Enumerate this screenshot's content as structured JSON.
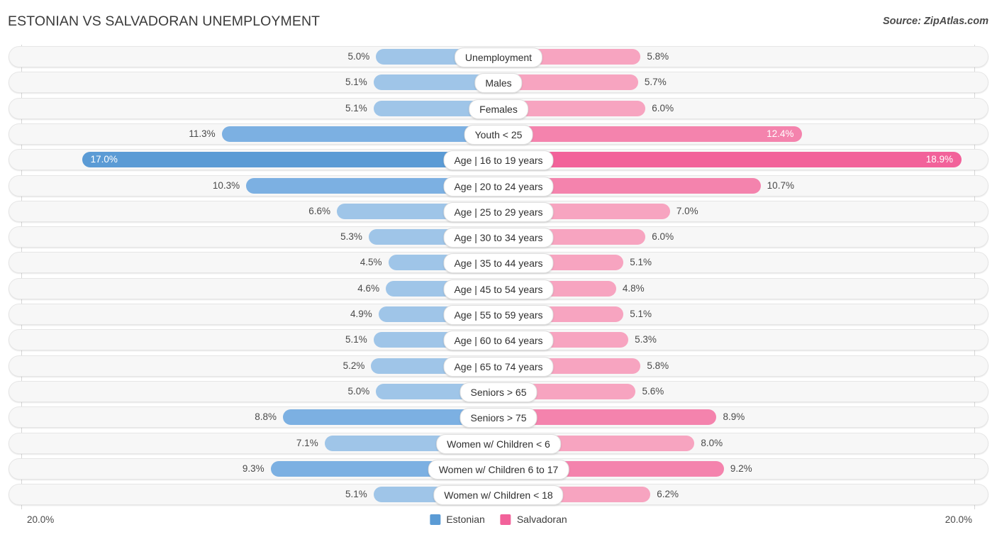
{
  "header": {
    "title": "ESTONIAN VS SALVADORAN UNEMPLOYMENT",
    "source": "Source: ZipAtlas.com"
  },
  "axis": {
    "left_max": "20.0%",
    "right_max": "20.0%"
  },
  "legend": {
    "items": [
      {
        "label": "Estonian",
        "color": "#5b9bd5"
      },
      {
        "label": "Salvadoran",
        "color": "#f2629a"
      }
    ]
  },
  "colors": {
    "left_normal": "#9fc5e8",
    "left_mid": "#7cb0e2",
    "left_high": "#5b9bd5",
    "right_normal": "#f7a4c0",
    "right_mid": "#f483ad",
    "right_high": "#f2629a",
    "track_bg": "#f7f7f7",
    "track_border": "#e6e6e6"
  },
  "chart_data": {
    "type": "bar",
    "title": "ESTONIAN VS SALVADORAN UNEMPLOYMENT",
    "subtitle": "",
    "orientation": "horizontal-diverging",
    "xlabel": "",
    "ylabel": "",
    "xlim": [
      0,
      20
    ],
    "axis_max_label": "20.0%",
    "grid": false,
    "legend_position": "bottom-center",
    "categories": [
      "Unemployment",
      "Males",
      "Females",
      "Youth < 25",
      "Age | 16 to 19 years",
      "Age | 20 to 24 years",
      "Age | 25 to 29 years",
      "Age | 30 to 34 years",
      "Age | 35 to 44 years",
      "Age | 45 to 54 years",
      "Age | 55 to 59 years",
      "Age | 60 to 64 years",
      "Age | 65 to 74 years",
      "Seniors > 65",
      "Seniors > 75",
      "Women w/ Children < 6",
      "Women w/ Children 6 to 17",
      "Women w/ Children < 18"
    ],
    "series": [
      {
        "name": "Estonian",
        "side": "left",
        "values": [
          5.0,
          5.1,
          5.1,
          11.3,
          17.0,
          10.3,
          6.6,
          5.3,
          4.5,
          4.6,
          4.9,
          5.1,
          5.2,
          5.0,
          8.8,
          7.1,
          9.3,
          5.1
        ],
        "labels": [
          "5.0%",
          "5.1%",
          "5.1%",
          "11.3%",
          "17.0%",
          "10.3%",
          "6.6%",
          "5.3%",
          "4.5%",
          "4.6%",
          "4.9%",
          "5.1%",
          "5.2%",
          "5.0%",
          "8.8%",
          "7.1%",
          "9.3%",
          "5.1%"
        ]
      },
      {
        "name": "Salvadoran",
        "side": "right",
        "values": [
          5.8,
          5.7,
          6.0,
          12.4,
          18.9,
          10.7,
          7.0,
          6.0,
          5.1,
          4.8,
          5.1,
          5.3,
          5.8,
          5.6,
          8.9,
          8.0,
          9.2,
          6.2
        ],
        "labels": [
          "5.8%",
          "5.7%",
          "6.0%",
          "12.4%",
          "18.9%",
          "10.7%",
          "7.0%",
          "6.0%",
          "5.1%",
          "4.8%",
          "5.1%",
          "5.3%",
          "5.8%",
          "5.6%",
          "8.9%",
          "8.0%",
          "9.2%",
          "6.2%"
        ]
      }
    ],
    "rows": [
      {
        "label": "Unemployment",
        "left": 5.0,
        "left_label": "5.0%",
        "right": 5.8,
        "right_label": "5.8%",
        "left_shade": "normal",
        "right_shade": "normal",
        "left_inside": false,
        "right_inside": false
      },
      {
        "label": "Males",
        "left": 5.1,
        "left_label": "5.1%",
        "right": 5.7,
        "right_label": "5.7%",
        "left_shade": "normal",
        "right_shade": "normal",
        "left_inside": false,
        "right_inside": false
      },
      {
        "label": "Females",
        "left": 5.1,
        "left_label": "5.1%",
        "right": 6.0,
        "right_label": "6.0%",
        "left_shade": "normal",
        "right_shade": "normal",
        "left_inside": false,
        "right_inside": false
      },
      {
        "label": "Youth < 25",
        "left": 11.3,
        "left_label": "11.3%",
        "right": 12.4,
        "right_label": "12.4%",
        "left_shade": "mid",
        "right_shade": "mid",
        "left_inside": false,
        "right_inside": true
      },
      {
        "label": "Age | 16 to 19 years",
        "left": 17.0,
        "left_label": "17.0%",
        "right": 18.9,
        "right_label": "18.9%",
        "left_shade": "high",
        "right_shade": "high",
        "left_inside": true,
        "right_inside": true
      },
      {
        "label": "Age | 20 to 24 years",
        "left": 10.3,
        "left_label": "10.3%",
        "right": 10.7,
        "right_label": "10.7%",
        "left_shade": "mid",
        "right_shade": "mid",
        "left_inside": false,
        "right_inside": false
      },
      {
        "label": "Age | 25 to 29 years",
        "left": 6.6,
        "left_label": "6.6%",
        "right": 7.0,
        "right_label": "7.0%",
        "left_shade": "normal",
        "right_shade": "normal",
        "left_inside": false,
        "right_inside": false
      },
      {
        "label": "Age | 30 to 34 years",
        "left": 5.3,
        "left_label": "5.3%",
        "right": 6.0,
        "right_label": "6.0%",
        "left_shade": "normal",
        "right_shade": "normal",
        "left_inside": false,
        "right_inside": false
      },
      {
        "label": "Age | 35 to 44 years",
        "left": 4.5,
        "left_label": "4.5%",
        "right": 5.1,
        "right_label": "5.1%",
        "left_shade": "normal",
        "right_shade": "normal",
        "left_inside": false,
        "right_inside": false
      },
      {
        "label": "Age | 45 to 54 years",
        "left": 4.6,
        "left_label": "4.6%",
        "right": 4.8,
        "right_label": "4.8%",
        "left_shade": "normal",
        "right_shade": "normal",
        "left_inside": false,
        "right_inside": false
      },
      {
        "label": "Age | 55 to 59 years",
        "left": 4.9,
        "left_label": "4.9%",
        "right": 5.1,
        "right_label": "5.1%",
        "left_shade": "normal",
        "right_shade": "normal",
        "left_inside": false,
        "right_inside": false
      },
      {
        "label": "Age | 60 to 64 years",
        "left": 5.1,
        "left_label": "5.1%",
        "right": 5.3,
        "right_label": "5.3%",
        "left_shade": "normal",
        "right_shade": "normal",
        "left_inside": false,
        "right_inside": false
      },
      {
        "label": "Age | 65 to 74 years",
        "left": 5.2,
        "left_label": "5.2%",
        "right": 5.8,
        "right_label": "5.8%",
        "left_shade": "normal",
        "right_shade": "normal",
        "left_inside": false,
        "right_inside": false
      },
      {
        "label": "Seniors > 65",
        "left": 5.0,
        "left_label": "5.0%",
        "right": 5.6,
        "right_label": "5.6%",
        "left_shade": "normal",
        "right_shade": "normal",
        "left_inside": false,
        "right_inside": false
      },
      {
        "label": "Seniors > 75",
        "left": 8.8,
        "left_label": "8.8%",
        "right": 8.9,
        "right_label": "8.9%",
        "left_shade": "mid",
        "right_shade": "mid",
        "left_inside": false,
        "right_inside": false
      },
      {
        "label": "Women w/ Children < 6",
        "left": 7.1,
        "left_label": "7.1%",
        "right": 8.0,
        "right_label": "8.0%",
        "left_shade": "normal",
        "right_shade": "normal",
        "left_inside": false,
        "right_inside": false
      },
      {
        "label": "Women w/ Children 6 to 17",
        "left": 9.3,
        "left_label": "9.3%",
        "right": 9.2,
        "right_label": "9.2%",
        "left_shade": "mid",
        "right_shade": "mid",
        "left_inside": false,
        "right_inside": false
      },
      {
        "label": "Women w/ Children < 18",
        "left": 5.1,
        "left_label": "5.1%",
        "right": 6.2,
        "right_label": "6.2%",
        "left_shade": "normal",
        "right_shade": "normal",
        "left_inside": false,
        "right_inside": false
      }
    ]
  }
}
